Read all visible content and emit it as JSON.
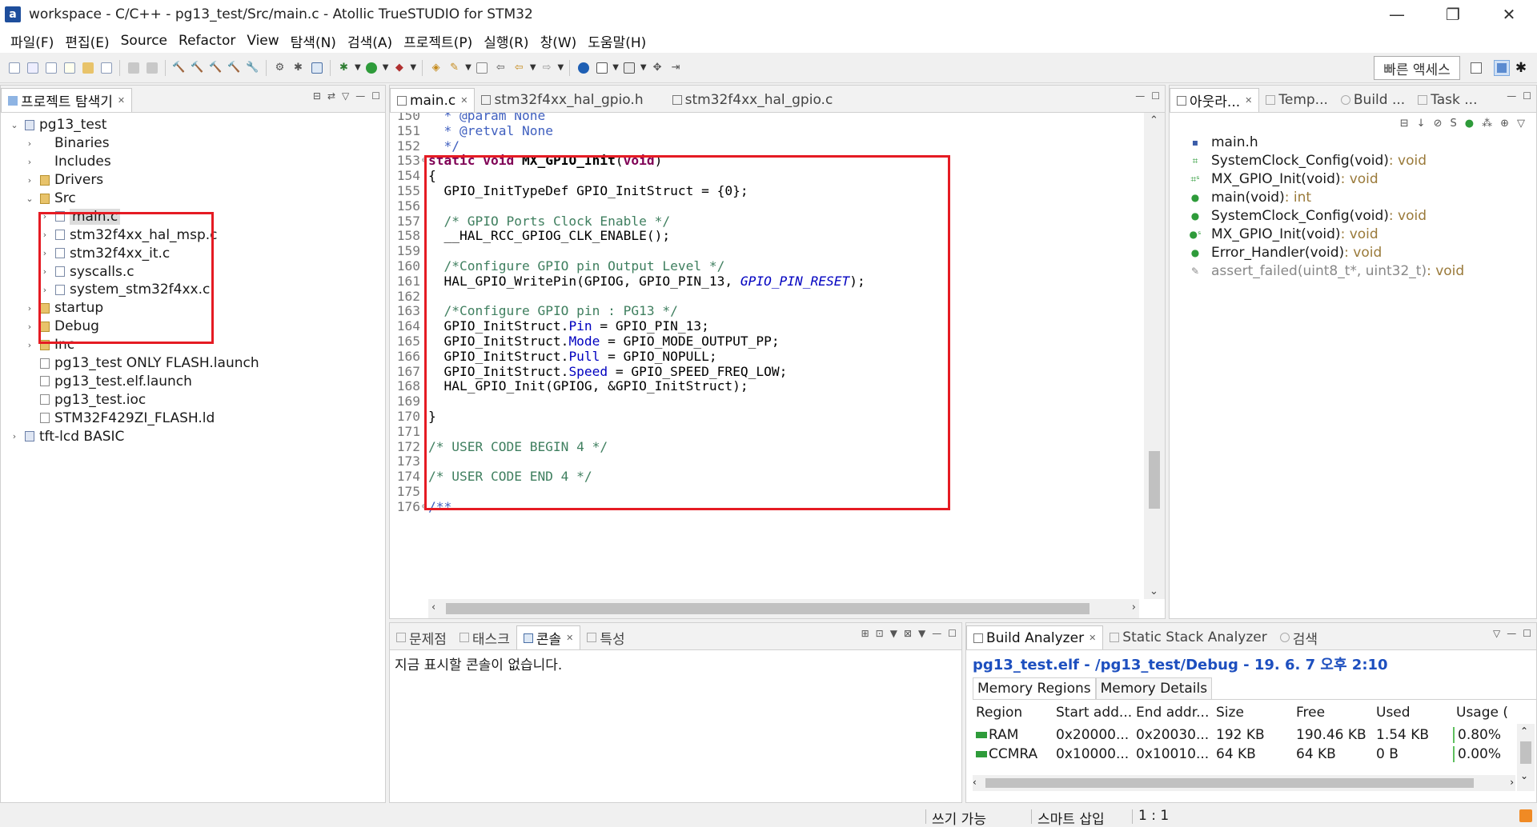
{
  "window": {
    "title": "workspace - C/C++ - pg13_test/Src/main.c - Atollic TrueSTUDIO for STM32",
    "minimize": "—",
    "maximize": "❐",
    "close": "✕"
  },
  "menu": [
    "파일(F)",
    "편집(E)",
    "Source",
    "Refactor",
    "View",
    "탐색(N)",
    "검색(A)",
    "프로젝트(P)",
    "실행(R)",
    "창(W)",
    "도움말(H)"
  ],
  "toolbar": {
    "quick_access": "빠른 액세스"
  },
  "project_explorer": {
    "tab_label": "프로젝트 탐색기",
    "items": [
      {
        "label": "pg13_test",
        "indent": 0,
        "arrow": "v",
        "icon": "project-icon"
      },
      {
        "label": "Binaries",
        "indent": 1,
        "arrow": ">",
        "icon": "binaries-icon"
      },
      {
        "label": "Includes",
        "indent": 1,
        "arrow": ">",
        "icon": "includes-icon"
      },
      {
        "label": "Drivers",
        "indent": 1,
        "arrow": ">",
        "icon": "folder-icon"
      },
      {
        "label": "Src",
        "indent": 1,
        "arrow": "v",
        "icon": "folder-icon"
      },
      {
        "label": "main.c",
        "indent": 2,
        "arrow": ">",
        "icon": "c-file-icon",
        "selected": true
      },
      {
        "label": "stm32f4xx_hal_msp.c",
        "indent": 2,
        "arrow": ">",
        "icon": "c-file-icon"
      },
      {
        "label": "stm32f4xx_it.c",
        "indent": 2,
        "arrow": ">",
        "icon": "c-file-icon"
      },
      {
        "label": "syscalls.c",
        "indent": 2,
        "arrow": ">",
        "icon": "c-file-icon"
      },
      {
        "label": "system_stm32f4xx.c",
        "indent": 2,
        "arrow": ">",
        "icon": "c-file-icon"
      },
      {
        "label": "startup",
        "indent": 1,
        "arrow": ">",
        "icon": "folder-icon"
      },
      {
        "label": "Debug",
        "indent": 1,
        "arrow": ">",
        "icon": "folder-icon"
      },
      {
        "label": "Inc",
        "indent": 1,
        "arrow": ">",
        "icon": "folder-icon"
      },
      {
        "label": "pg13_test ONLY FLASH.launch",
        "indent": 1,
        "arrow": "",
        "icon": "file-icon"
      },
      {
        "label": "pg13_test.elf.launch",
        "indent": 1,
        "arrow": "",
        "icon": "file-icon"
      },
      {
        "label": "pg13_test.ioc",
        "indent": 1,
        "arrow": "",
        "icon": "file-icon"
      },
      {
        "label": "STM32F429ZI_FLASH.ld",
        "indent": 1,
        "arrow": "",
        "icon": "file-icon"
      },
      {
        "label": "tft-lcd BASIC",
        "indent": 0,
        "arrow": ">",
        "icon": "project-icon"
      }
    ]
  },
  "editor": {
    "tabs": [
      {
        "label": "main.c",
        "active": true
      },
      {
        "label": "stm32f4xx_hal_gpio.h",
        "active": false
      },
      {
        "label": "stm32f4xx_hal_gpio.c",
        "active": false
      }
    ],
    "lines": [
      {
        "n": "150",
        "fold": "",
        "html": "  <span class=\"doc\">* @param None</span>"
      },
      {
        "n": "151",
        "fold": "",
        "html": "  <span class=\"doc\">* @retval None</span>"
      },
      {
        "n": "152",
        "fold": "",
        "html": "  <span class=\"doc\">*/</span>"
      },
      {
        "n": "153",
        "fold": "⊖",
        "html": "<span class=\"kw\">static</span> <span class=\"kw\">void</span> <b>MX_GPIO_Init</b>(<span class=\"kw\">void</span>)"
      },
      {
        "n": "154",
        "fold": "",
        "html": "{"
      },
      {
        "n": "155",
        "fold": "",
        "html": "  GPIO_InitTypeDef GPIO_InitStruct = {0};"
      },
      {
        "n": "156",
        "fold": "",
        "html": ""
      },
      {
        "n": "157",
        "fold": "",
        "html": "  <span class=\"cm\">/* GPIO Ports Clock Enable */</span>"
      },
      {
        "n": "158",
        "fold": "",
        "html": "  __HAL_RCC_GPIOG_CLK_ENABLE();"
      },
      {
        "n": "159",
        "fold": "",
        "html": ""
      },
      {
        "n": "160",
        "fold": "",
        "html": "  <span class=\"cm\">/*Configure GPIO pin Output Level */</span>"
      },
      {
        "n": "161",
        "fold": "",
        "html": "  HAL_GPIO_WritePin(GPIOG, GPIO_PIN_13, <span class=\"mac\">GPIO_PIN_RESET</span>);"
      },
      {
        "n": "162",
        "fold": "",
        "html": ""
      },
      {
        "n": "163",
        "fold": "",
        "html": "  <span class=\"cm\">/*Configure GPIO pin : PG13 */</span>"
      },
      {
        "n": "164",
        "fold": "",
        "html": "  GPIO_InitStruct.<span class=\"fld\">Pin</span> = GPIO_PIN_13;"
      },
      {
        "n": "165",
        "fold": "",
        "html": "  GPIO_InitStruct.<span class=\"fld\">Mode</span> = GPIO_MODE_OUTPUT_PP;"
      },
      {
        "n": "166",
        "fold": "",
        "html": "  GPIO_InitStruct.<span class=\"fld\">Pull</span> = GPIO_NOPULL;"
      },
      {
        "n": "167",
        "fold": "",
        "html": "  GPIO_InitStruct.<span class=\"fld\">Speed</span> = GPIO_SPEED_FREQ_LOW;"
      },
      {
        "n": "168",
        "fold": "",
        "html": "  HAL_GPIO_Init(GPIOG, &amp;GPIO_InitStruct);"
      },
      {
        "n": "169",
        "fold": "",
        "html": ""
      },
      {
        "n": "170",
        "fold": "",
        "html": "}"
      },
      {
        "n": "171",
        "fold": "",
        "html": ""
      },
      {
        "n": "172",
        "fold": "",
        "html": "<span class=\"cm\">/* USER CODE BEGIN 4 */</span>"
      },
      {
        "n": "173",
        "fold": "",
        "html": ""
      },
      {
        "n": "174",
        "fold": "",
        "html": "<span class=\"cm\">/* USER CODE END 4 */</span>"
      },
      {
        "n": "175",
        "fold": "",
        "html": ""
      },
      {
        "n": "176",
        "fold": "⊖",
        "html": "<span class=\"doc\">/**</span>"
      }
    ]
  },
  "outline": {
    "tabs": [
      {
        "label": "아웃라...",
        "active": true
      },
      {
        "label": "Temp...",
        "active": false
      },
      {
        "label": "Build ...",
        "active": false
      },
      {
        "label": "Task ...",
        "active": false
      }
    ],
    "items": [
      {
        "name": "main.h",
        "type": "",
        "icon": "include-icon",
        "dim": false
      },
      {
        "name": "SystemClock_Config(void)",
        "type": " : void",
        "icon": "declaration-icon",
        "dim": false
      },
      {
        "name": "MX_GPIO_Init(void)",
        "type": " : void",
        "icon": "static-declaration-icon",
        "dim": false
      },
      {
        "name": "main(void)",
        "type": " : int",
        "icon": "function-icon",
        "dim": false
      },
      {
        "name": "SystemClock_Config(void)",
        "type": " : void",
        "icon": "function-icon",
        "dim": false
      },
      {
        "name": "MX_GPIO_Init(void)",
        "type": " : void",
        "icon": "static-function-icon",
        "dim": false
      },
      {
        "name": "Error_Handler(void)",
        "type": " : void",
        "icon": "function-icon",
        "dim": false
      },
      {
        "name": "assert_failed(uint8_t*, uint32_t)",
        "type": " : void",
        "icon": "inactive-function-icon",
        "dim": true
      }
    ]
  },
  "console": {
    "tabs": [
      {
        "label": "문제점",
        "active": false
      },
      {
        "label": "태스크",
        "active": false
      },
      {
        "label": "콘솔",
        "active": true
      },
      {
        "label": "특성",
        "active": false
      }
    ],
    "message": "지금 표시할 콘솔이 없습니다."
  },
  "build_analyzer": {
    "tabs": [
      {
        "label": "Build Analyzer",
        "active": true
      },
      {
        "label": "Static Stack Analyzer",
        "active": false
      },
      {
        "label": "검색",
        "active": false
      }
    ],
    "heading": "pg13_test.elf - /pg13_test/Debug - 19. 6. 7 오후 2:10",
    "subtabs": [
      "Memory Regions",
      "Memory Details"
    ],
    "columns": [
      "Region",
      "Start add...",
      "End addr...",
      "Size",
      "Free",
      "Used",
      "Usage ("
    ],
    "rows": [
      [
        "RAM",
        "0x20000...",
        "0x20030...",
        "192 KB",
        "190.46 KB",
        "1.54 KB",
        "0.80%"
      ],
      [
        "CCMRA",
        "0x10000...",
        "0x10010...",
        "64 KB",
        "64 KB",
        "0 B",
        "0.00%"
      ]
    ]
  },
  "status": {
    "write_mode": "쓰기 가능",
    "insert_mode": "스마트 삽입",
    "position": "1 : 1"
  },
  "colors": {
    "highlight_box": "#e51b23",
    "keyword": "#7f0055",
    "comment": "#3f7f5f",
    "link_heading": "#1d4fbf"
  }
}
